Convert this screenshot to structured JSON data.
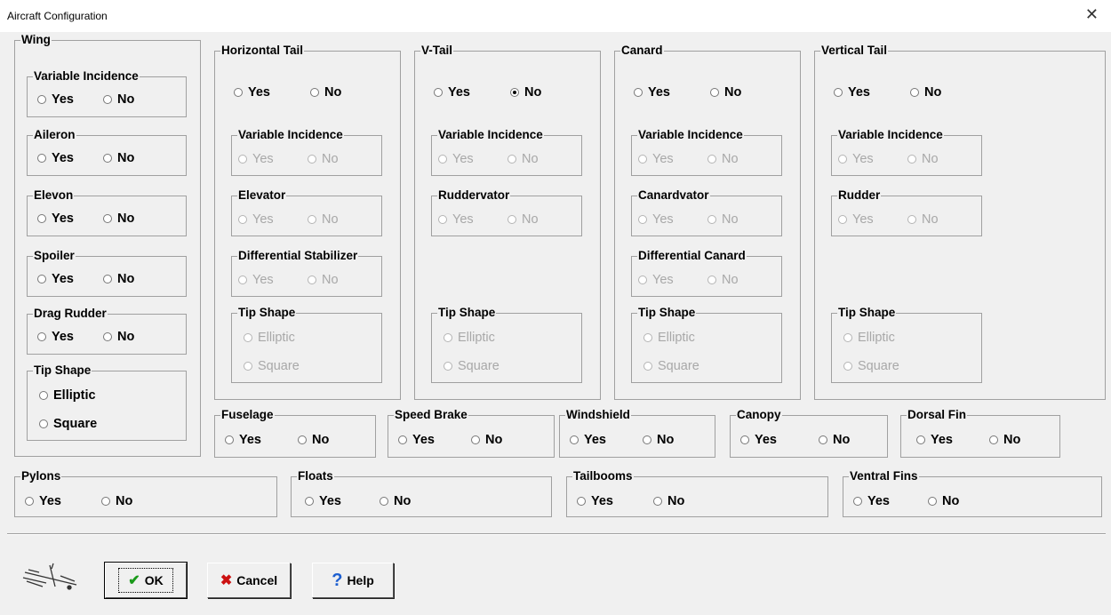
{
  "window": {
    "title": "Aircraft Configuration",
    "close_glyph": "✕"
  },
  "yes": "Yes",
  "no": "No",
  "elliptic": "Elliptic",
  "square": "Square",
  "groups": {
    "wing": "Wing",
    "variable_incidence": "Variable Incidence",
    "aileron": "Aileron",
    "elevon": "Elevon",
    "spoiler": "Spoiler",
    "drag_rudder": "Drag Rudder",
    "tip_shape": "Tip Shape",
    "horizontal_tail": "Horizontal Tail",
    "elevator": "Elevator",
    "differential_stabilizer": "Differential Stabilizer",
    "v_tail": "V-Tail",
    "ruddervator": "Ruddervator",
    "canard": "Canard",
    "canardvator": "Canardvator",
    "differential_canard": "Differential Canard",
    "vertical_tail": "Vertical Tail",
    "rudder": "Rudder",
    "fuselage": "Fuselage",
    "speed_brake": "Speed Brake",
    "windshield": "Windshield",
    "canopy": "Canopy",
    "dorsal_fin": "Dorsal Fin",
    "pylons": "Pylons",
    "floats": "Floats",
    "tailbooms": "Tailbooms",
    "ventral_fins": "Ventral Fins"
  },
  "selected": {
    "v_tail": "No"
  },
  "buttons": {
    "ok": "OK",
    "cancel": "Cancel",
    "help": "Help"
  },
  "icons": {
    "ok": "checkmark-icon",
    "cancel": "x-icon",
    "help": "question-icon",
    "logo": "airplane-icon"
  },
  "colors": {
    "ok_icon": "#1a9a1a",
    "cancel_icon": "#cc1111",
    "help_icon": "#1d5fd0",
    "disabled_text": "#a8a8a8"
  }
}
